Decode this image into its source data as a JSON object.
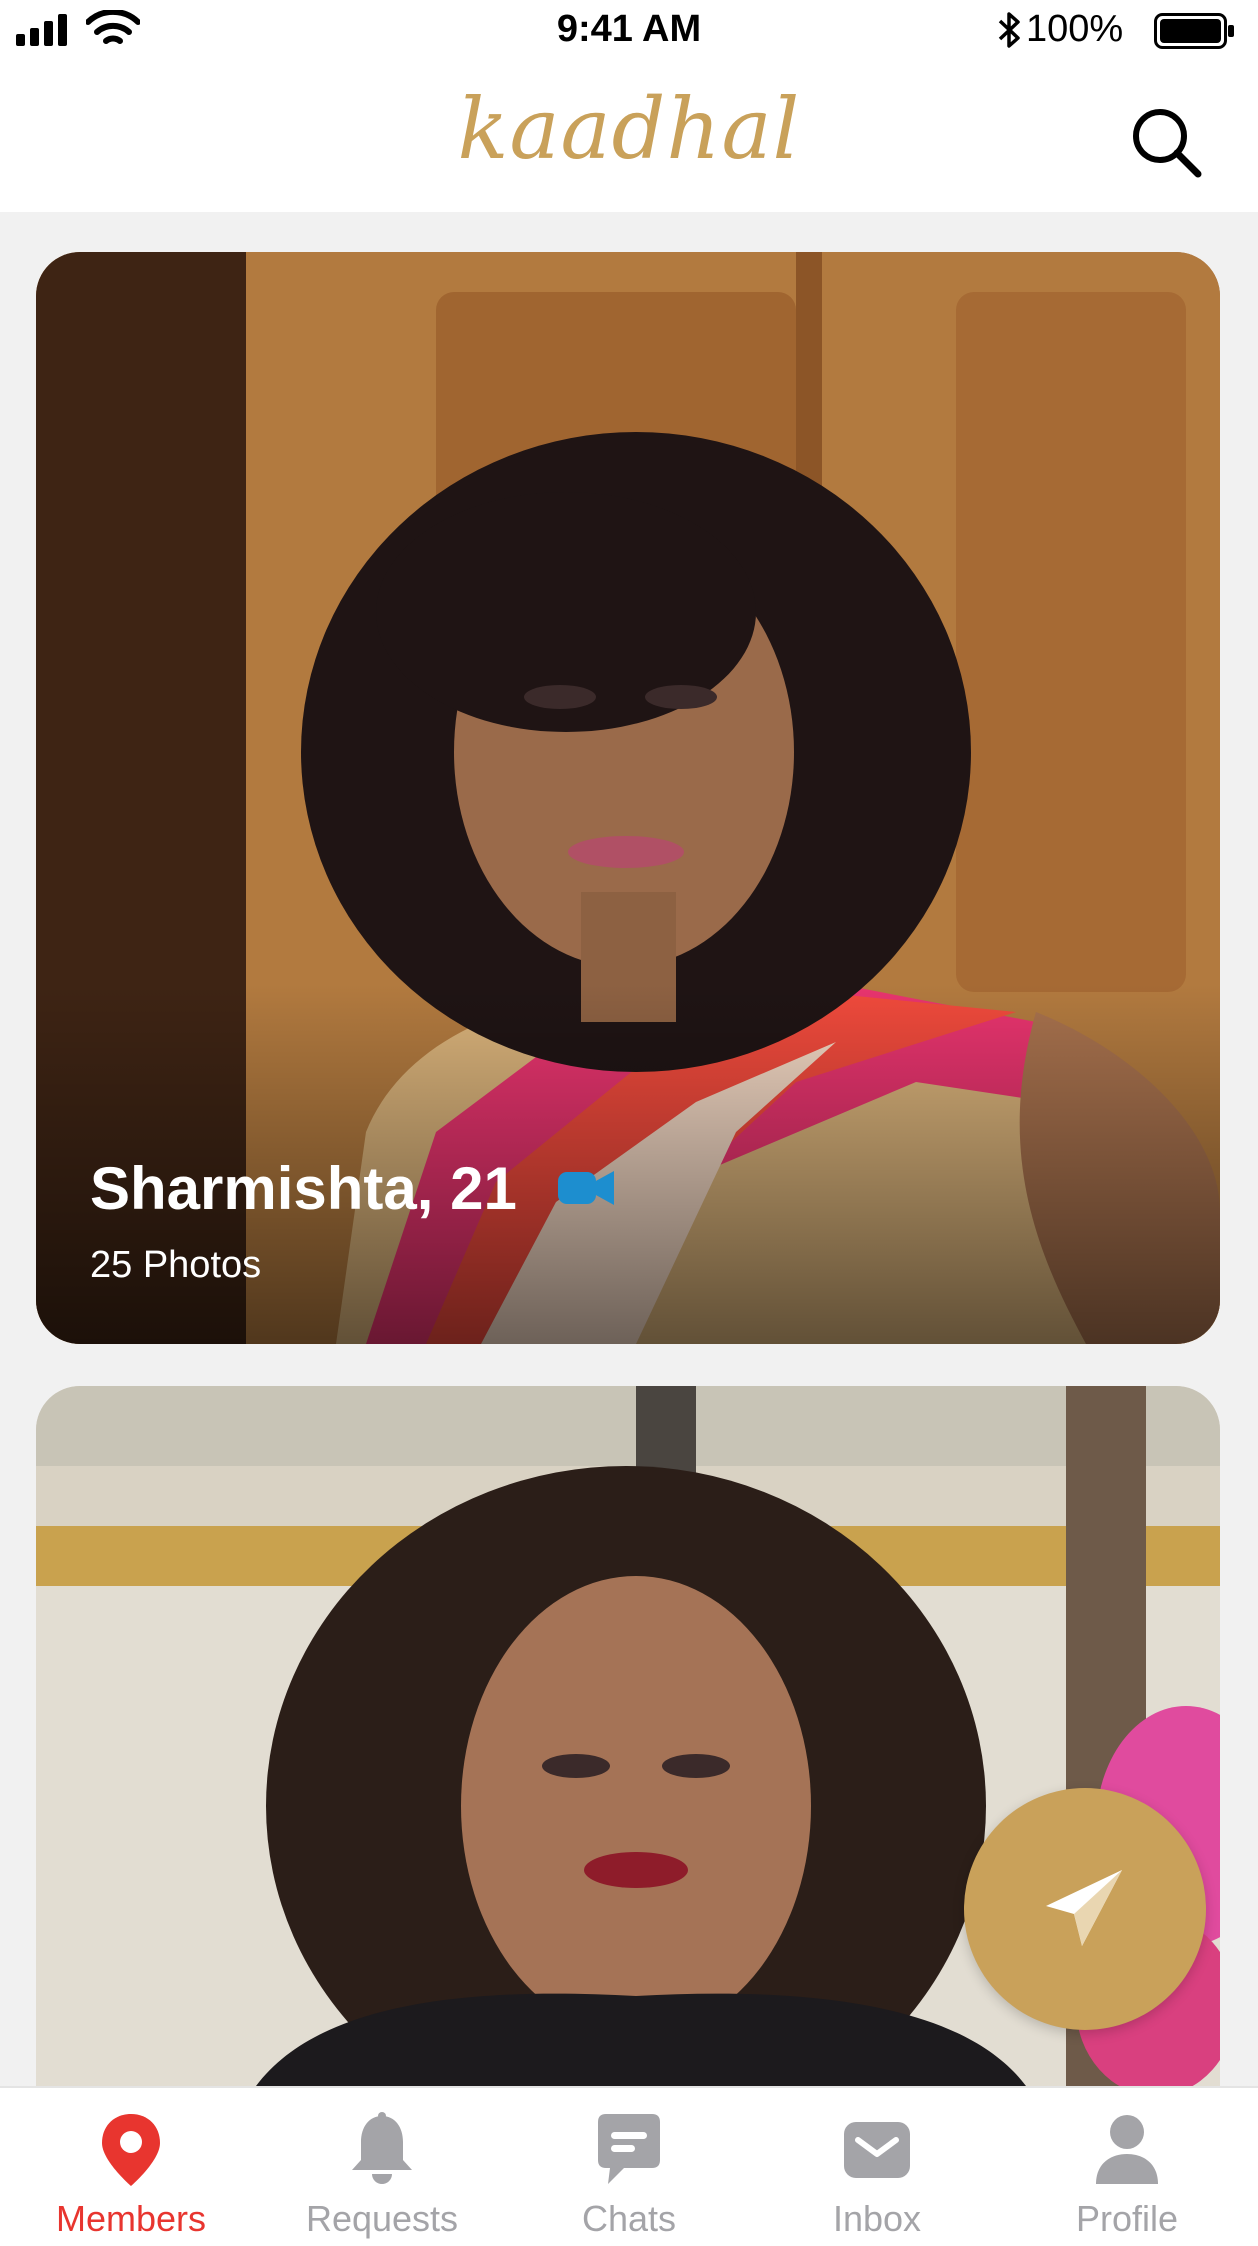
{
  "status_bar": {
    "time": "9:41 AM",
    "battery": "100%"
  },
  "header": {
    "logo": "kaadhal",
    "search_icon": "search-icon"
  },
  "cards": [
    {
      "name": "Sharmishta, 21",
      "photos": "25 Photos",
      "video_icon": "video-camera-icon"
    },
    {}
  ],
  "fab": {
    "icon": "paper-plane-icon"
  },
  "tabs": [
    {
      "label": "Members",
      "icon": "location-pin-icon",
      "active": true
    },
    {
      "label": "Requests",
      "icon": "bell-icon"
    },
    {
      "label": "Chats",
      "icon": "chat-bubble-icon"
    },
    {
      "label": "Inbox",
      "icon": "envelope-icon"
    },
    {
      "label": "Profile",
      "icon": "person-icon"
    }
  ],
  "colors": {
    "brand_gold": "#c9a15a",
    "active_tab": "#e8352f",
    "inactive_tab": "#a4a4a8",
    "video_blue": "#1d8ecf"
  }
}
